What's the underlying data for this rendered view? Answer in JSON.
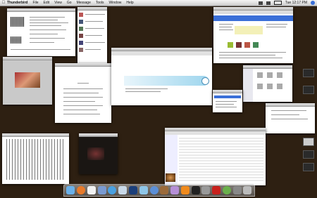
{
  "menubar": {
    "app": "Thunderbird",
    "items": [
      "File",
      "Edit",
      "View",
      "Go",
      "Message",
      "Tools",
      "Window",
      "Help"
    ],
    "clock": "Tue 12:17 PM"
  },
  "colors": {
    "desktop": "#2e2012",
    "accent_blue": "#3a6fd8"
  },
  "icons": {
    "apple": "apple-icon",
    "search": "spotlight-icon",
    "dock": [
      "finder-icon",
      "firefox-icon",
      "ical-icon",
      "mail-icon",
      "safari-icon",
      "itunes-icon",
      "photoshop-icon",
      "iphoto-icon",
      "itunes-note-icon",
      "address-book-icon",
      "preview-icon",
      "vlc-icon",
      "terminal-icon",
      "calculator-icon",
      "acrobat-icon",
      "ichat-icon",
      "system-prefs-icon",
      "trash-icon"
    ]
  }
}
